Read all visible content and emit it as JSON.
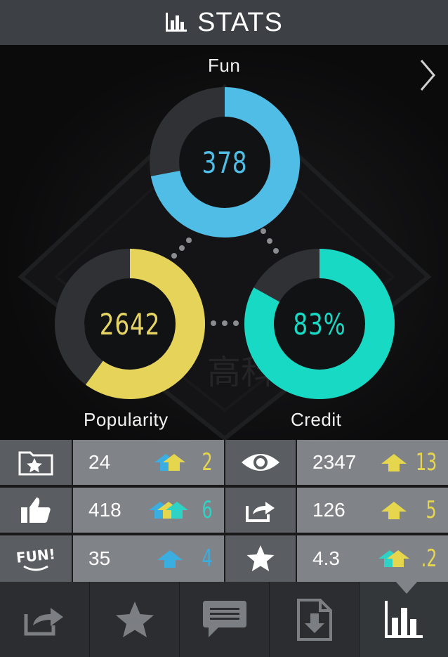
{
  "header": {
    "title": "STATS",
    "icon": "bar-chart-icon"
  },
  "stats": {
    "fun": {
      "label": "Fun",
      "value": "378",
      "fraction": 0.72,
      "color": "#4fbde6",
      "color_light": "#8de0ea"
    },
    "popularity": {
      "label": "Popularity",
      "value": "2642",
      "fraction": 0.6,
      "color": "#e5d35a",
      "color_light": "#efe6a6"
    },
    "credit": {
      "label": "Credit",
      "value": "83%",
      "fraction": 0.83,
      "color": "#17d9c4",
      "color_light": "#9ee9ee"
    }
  },
  "watermark": "高科",
  "table": {
    "rows": [
      {
        "left_icon": "folder-star-icon",
        "left_value": "24",
        "left_delta": "2",
        "left_delta_color": "#e6d64d",
        "right_icon": "eye-icon",
        "right_value": "2347",
        "right_delta": "13",
        "right_delta_color": "#e6d64d"
      },
      {
        "left_icon": "thumbs-up-icon",
        "left_value": "418",
        "left_delta": "6",
        "left_delta_color": "#2ed3c6",
        "right_icon": "share-icon",
        "right_value": "126",
        "right_delta": "5",
        "right_delta_color": "#e6d64d"
      },
      {
        "left_icon": "fun-badge-icon",
        "left_value": "35",
        "left_delta": "4",
        "left_delta_color": "#3aaee0",
        "right_icon": "star-icon",
        "right_value": "4.3",
        "right_delta": ".2",
        "right_delta_color": "#e6d64d"
      }
    ],
    "fun_badge_text": "FUN!"
  },
  "nav": {
    "items": [
      {
        "icon": "share-icon",
        "active": false
      },
      {
        "icon": "star-icon",
        "active": false
      },
      {
        "icon": "comment-icon",
        "active": false
      },
      {
        "icon": "download-file-icon",
        "active": false
      },
      {
        "icon": "bar-chart-icon",
        "active": true
      }
    ]
  }
}
